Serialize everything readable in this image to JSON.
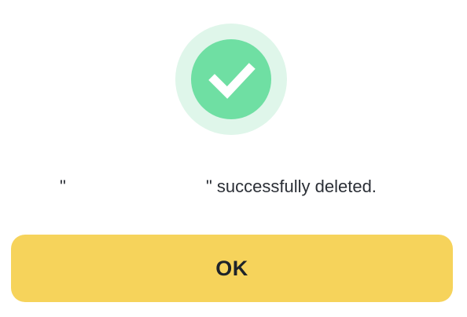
{
  "dialog": {
    "icon": "check-icon",
    "message": {
      "quote_open": "\"",
      "item_name": "",
      "suffix": "\" successfully deleted."
    },
    "ok_label": "OK"
  },
  "colors": {
    "success_halo": "#dff6ea",
    "success_fill": "#6fdfa3",
    "button_bg": "#f6d35b",
    "text": "#2b2f36"
  }
}
